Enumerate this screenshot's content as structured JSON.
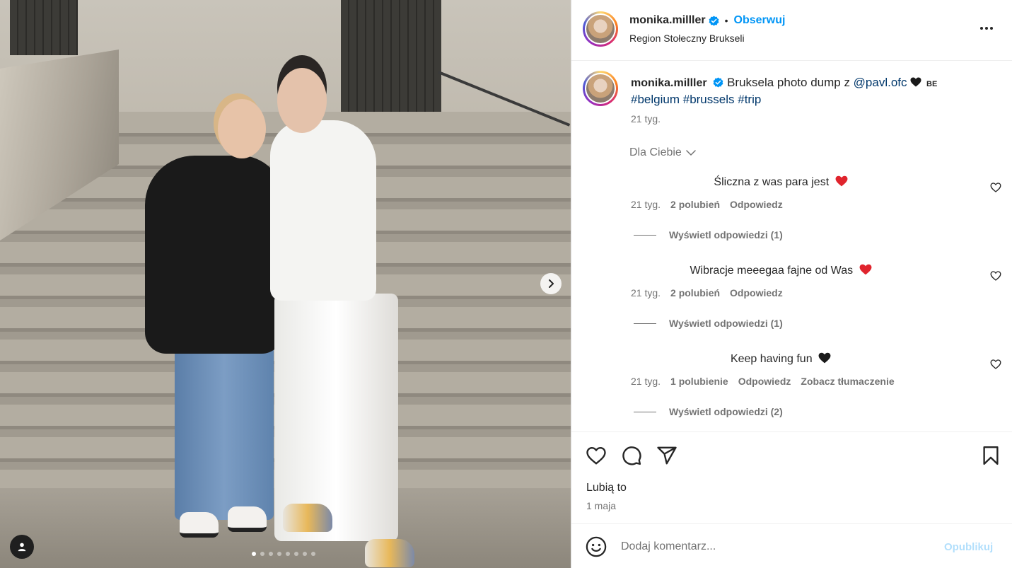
{
  "post": {
    "username": "monika.milller",
    "separator": "•",
    "follow_label": "Obserwuj",
    "location": "Region Stołeczny Brukseli",
    "caption_text": "Bruksela photo dump z ",
    "caption_mention": "@pavl.ofc",
    "caption_flag": "BE",
    "hashtags": [
      "#belgium",
      "#brussels",
      "#trip"
    ],
    "caption_time": "21 tyg.",
    "sort_label": "Dla Ciebie",
    "carousel": {
      "slides": 8,
      "active_slide": 1
    }
  },
  "comments": [
    {
      "text": "Śliczna z was para jest",
      "emoji": "red-heart",
      "time": "21 tyg.",
      "likes": "2 polubień",
      "reply": "Odpowiedz",
      "translate": "",
      "view_replies": "Wyświetl odpowiedzi (1)"
    },
    {
      "text": "Wibracje meeegaa fajne od Was",
      "emoji": "red-heart",
      "time": "21 tyg.",
      "likes": "2 polubień",
      "reply": "Odpowiedz",
      "translate": "",
      "view_replies": "Wyświetl odpowiedzi (1)"
    },
    {
      "text": "Keep having fun",
      "emoji": "black-heart",
      "time": "21 tyg.",
      "likes": "1 polubienie",
      "reply": "Odpowiedz",
      "translate": "Zobacz tłumaczenie",
      "view_replies": "Wyświetl odpowiedzi (2)"
    }
  ],
  "actions": {
    "likes_label": "Lubią to",
    "date": "1 maja",
    "icons": [
      "heart-icon",
      "comment-icon",
      "share-icon",
      "bookmark-icon"
    ]
  },
  "composer": {
    "placeholder": "Dodaj komentarz...",
    "post_label": "Opublikuj"
  },
  "colors": {
    "accent": "#0095f6",
    "link": "#00376b",
    "muted": "#737373",
    "heart_red": "#ed4956"
  }
}
